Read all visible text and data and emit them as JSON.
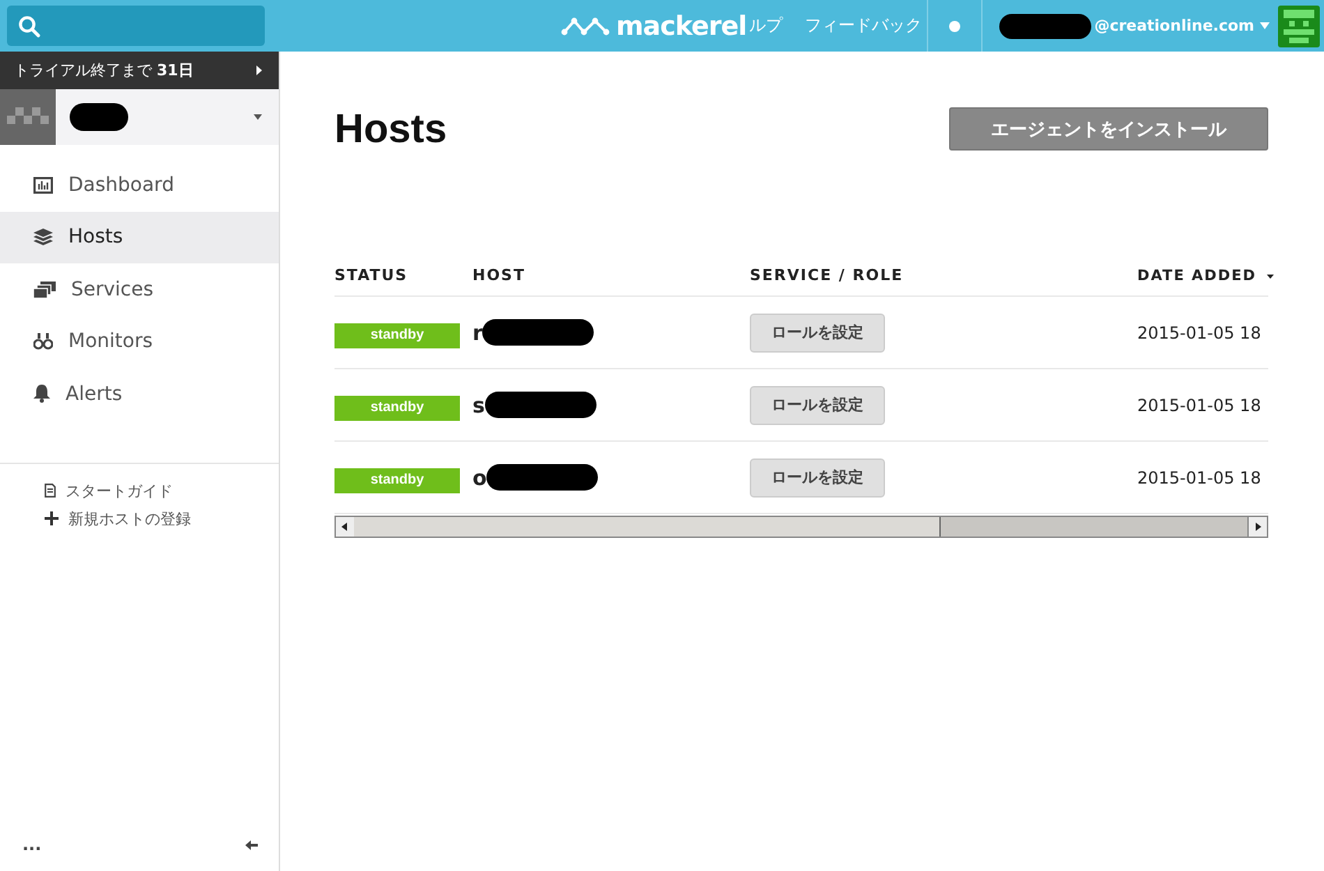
{
  "header": {
    "logo": "mackerel",
    "nav": [
      "ルプ",
      "フィードバック"
    ],
    "user_email": "@creationline.com"
  },
  "sidebar": {
    "trial": {
      "text": "トライアル終了まで ",
      "days": "31日"
    },
    "items": [
      {
        "label": "Dashboard",
        "selected": false
      },
      {
        "label": "Hosts",
        "selected": true
      },
      {
        "label": "Services",
        "selected": false
      },
      {
        "label": "Monitors",
        "selected": false
      },
      {
        "label": "Alerts",
        "selected": false
      }
    ],
    "links": [
      "スタートガイド",
      "新規ホストの登録"
    ],
    "footer": "..."
  },
  "main": {
    "title": "Hosts",
    "install_button": "エージェントをインストール",
    "table": {
      "columns": [
        "STATUS",
        "HOST",
        "SERVICE / ROLE",
        "DATE ADDED"
      ],
      "rows": [
        {
          "status": "standby",
          "host": "r",
          "role_button": "ロールを設定",
          "date_added": "2015-01-05 18"
        },
        {
          "status": "standby",
          "host": "s",
          "role_button": "ロールを設定",
          "date_added": "2015-01-05 18"
        },
        {
          "status": "standby",
          "host": "o",
          "role_button": "ロールを設定",
          "date_added": "2015-01-05 18"
        }
      ]
    }
  }
}
